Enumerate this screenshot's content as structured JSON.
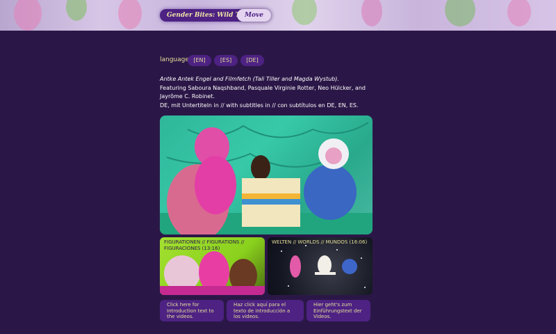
{
  "nav": {
    "title": "Gender Bites: Wild Tongues",
    "move_label": "Move"
  },
  "languages": {
    "label": "languages:",
    "options": [
      "[EN]",
      "[ES]",
      "[DE]"
    ]
  },
  "credits": {
    "line1": "Antke Antek Engel and Filmfetch (Tali Tiller and Magda Wystub).",
    "line2": "Featuring Saboura Naqshband, Pasquale Virginie Rotter, Neo Hülcker, and Jayrôme C. Robinet.",
    "line3": "DE, mit Untertiteln in // with subtitles in // con subtítulos en DE, EN, ES."
  },
  "videos": [
    {
      "caption": "FIGURATIONEN // FIGURATIONS // FIGURACIONES (13:16)"
    },
    {
      "caption": "WELTEN // WORLDS // MUNDOS (16:06)"
    }
  ],
  "intro_buttons": [
    "Click here for Introduction text to the videos.",
    "Haz click aquí para el texto de introducción a los videos.",
    "Hier geht's zum Einführungstext der Videos."
  ],
  "colors": {
    "background": "#2b1747",
    "accent_purple": "#4d2283",
    "accent_yellow": "#e7df9a"
  }
}
